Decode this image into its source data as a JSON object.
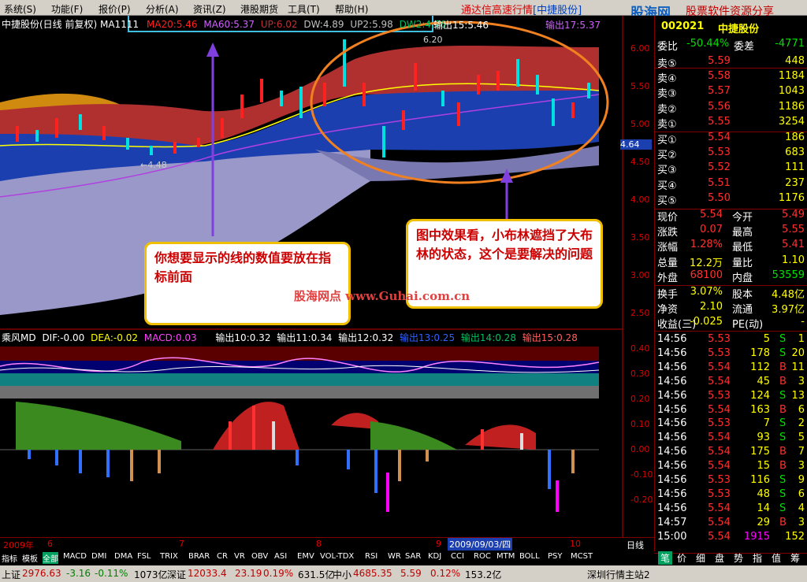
{
  "menu": {
    "items": [
      "系统(S)",
      "功能(F)",
      "报价(P)",
      "分析(A)",
      "资讯(Z)",
      "港股期货",
      "工具(T)",
      "帮助(H)"
    ],
    "app_title": "通达信高速行情",
    "app_title2": "[中捷股份]",
    "logo": "股海网",
    "logo_sub": "股票软件资源分享"
  },
  "price_panel": {
    "header": "中捷股份(日线 前复权) MA1111",
    "ma20": "MA20:5.46",
    "ma60": "MA60:5.37",
    "up": "UP:6.02",
    "dw": "DW:4.89",
    "up2": "UP2:5.98",
    "dw2": "DW2:4.76",
    "out15": "输出15:5.46",
    "out17": "输出17:5.37",
    "low_marker": "←4.48",
    "high_marker": "6.20",
    "price_tag": "4.64",
    "yaxis": [
      "6.00",
      "5.50",
      "5.00",
      "4.50",
      "4.00",
      "3.50",
      "3.00",
      "2.50"
    ]
  },
  "macd_panel": {
    "header": "乘风MD",
    "dif": "DIF:-0.00",
    "dea": "DEA:-0.02",
    "macd": "MACD:0.03",
    "out10": "输出10:0.32",
    "out11": "输出11:0.34",
    "out12": "输出12:0.32",
    "out13": "输出13:0.25",
    "out14": "输出14:0.28",
    "out15": "输出15:0.28",
    "yaxis": [
      "0.40",
      "0.30",
      "0.20",
      "0.10",
      "0.00",
      "-0.10",
      "-0.20"
    ]
  },
  "notes": {
    "left": "你想要显示的线的数值要放在指标前面",
    "right": "图中效果看，小布林遮挡了大布林的状态，这个是要解决的问题",
    "watermark": "股海网点 www.Guhai.com.cn"
  },
  "timeline": {
    "year": "2009年",
    "months": [
      "6",
      "7",
      "8",
      "9",
      "10"
    ],
    "cursor_date": "2009/09/03/四",
    "period": "日线"
  },
  "indicator_tabs": [
    "指标",
    "模板",
    "全部",
    "MACD",
    "DMI",
    "DMA",
    "FSL",
    "TRIX",
    "BRAR",
    "CR",
    "VR",
    "OBV",
    "ASI",
    "EMV",
    "VOL-TDX",
    "RSI",
    "WR",
    "SAR",
    "KDJ",
    "CCI",
    "ROC",
    "MTM",
    "BOLL",
    "PSY",
    "MCST"
  ],
  "quote": {
    "code": "002021",
    "name": "中捷股份",
    "weibi_label": "委比",
    "weibi": "-50.44%",
    "weicha_label": "委差",
    "weicha": "-4771",
    "sells": [
      {
        "label": "卖⑤",
        "price": "5.59",
        "vol": "448"
      },
      {
        "label": "卖④",
        "price": "5.58",
        "vol": "1184"
      },
      {
        "label": "卖③",
        "price": "5.57",
        "vol": "1043"
      },
      {
        "label": "卖②",
        "price": "5.56",
        "vol": "1186"
      },
      {
        "label": "卖①",
        "price": "5.55",
        "vol": "3254"
      }
    ],
    "buys": [
      {
        "label": "买①",
        "price": "5.54",
        "vol": "186"
      },
      {
        "label": "买②",
        "price": "5.53",
        "vol": "683"
      },
      {
        "label": "买③",
        "price": "5.52",
        "vol": "111"
      },
      {
        "label": "买④",
        "price": "5.51",
        "vol": "237"
      },
      {
        "label": "买⑤",
        "price": "5.50",
        "vol": "1176"
      }
    ],
    "stats": [
      [
        "现价",
        "5.54",
        "今开",
        "5.49"
      ],
      [
        "涨跌",
        "0.07",
        "最高",
        "5.55"
      ],
      [
        "涨幅",
        "1.28%",
        "最低",
        "5.41"
      ],
      [
        "总量",
        "12.2万",
        "量比",
        "1.10"
      ],
      [
        "外盘",
        "68100",
        "内盘",
        "53559"
      ]
    ],
    "stats2": [
      [
        "换手",
        "3.07%",
        "股本",
        "4.48亿"
      ],
      [
        "净资",
        "2.10",
        "流通",
        "3.97亿"
      ],
      [
        "收益(三)",
        "-0.025",
        "PE(动)",
        "-"
      ]
    ],
    "ticks": [
      [
        "14:56",
        "5.53",
        "5",
        "S",
        "1"
      ],
      [
        "14:56",
        "5.53",
        "178",
        "S",
        "20"
      ],
      [
        "14:56",
        "5.54",
        "112",
        "B",
        "11"
      ],
      [
        "14:56",
        "5.54",
        "45",
        "B",
        "3"
      ],
      [
        "14:56",
        "5.53",
        "124",
        "S",
        "13"
      ],
      [
        "14:56",
        "5.54",
        "163",
        "B",
        "6"
      ],
      [
        "14:56",
        "5.53",
        "7",
        "S",
        "2"
      ],
      [
        "14:56",
        "5.54",
        "93",
        "S",
        "5"
      ],
      [
        "14:56",
        "5.54",
        "175",
        "B",
        "7"
      ],
      [
        "14:56",
        "5.54",
        "15",
        "B",
        "3"
      ],
      [
        "14:56",
        "5.53",
        "116",
        "S",
        "9"
      ],
      [
        "14:56",
        "5.53",
        "48",
        "S",
        "6"
      ],
      [
        "14:56",
        "5.54",
        "14",
        "S",
        "4"
      ],
      [
        "14:57",
        "5.54",
        "29",
        "B",
        "3"
      ],
      [
        "15:00",
        "5.54",
        "1915",
        "",
        "152"
      ]
    ],
    "right_tabs": [
      "笔",
      "价",
      "细",
      "盘",
      "势",
      "指",
      "值",
      "筹"
    ]
  },
  "status": {
    "sh_label": "上证",
    "sh": "2976.63",
    "sh_chg": "-3.16",
    "sh_pct": "-0.11%",
    "sh_amt": "1073亿",
    "sz_label": "深证",
    "sz": "12033.4",
    "sz_chg": "23.19",
    "sz_pct": "0.19%",
    "sz_amt": "631.5亿",
    "zx_label": "中小",
    "zx": "4685.35",
    "zx_chg": "5.59",
    "zx_pct": "0.12%",
    "zx_amt": "153.2亿",
    "server": "深圳行情主站2"
  }
}
